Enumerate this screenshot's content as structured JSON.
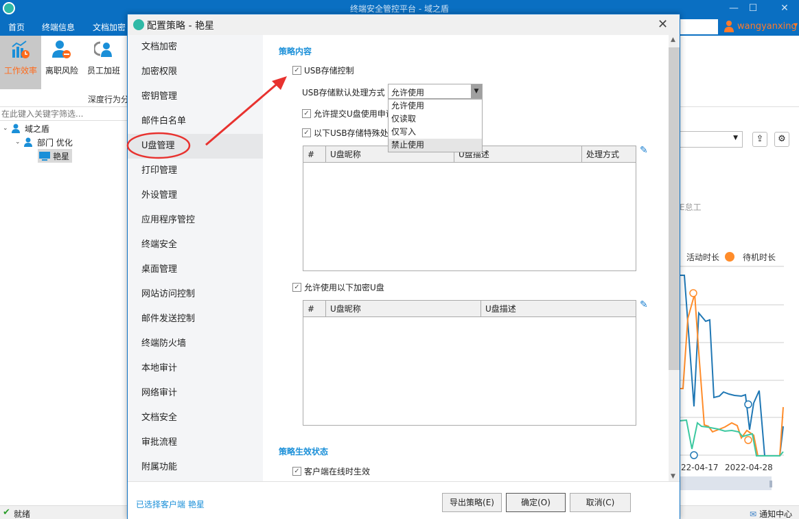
{
  "app": {
    "title": "终端安全管控平台 - 域之盾",
    "window_controls": {
      "minimize": "—",
      "maximize": "☐",
      "close": "✕"
    }
  },
  "menu": [
    "首页",
    "终端信息",
    "文档加密"
  ],
  "user": {
    "name": "wangyanxing"
  },
  "ribbon": {
    "buttons": [
      {
        "label": "工作效率",
        "icon": "efficiency-chart-icon",
        "active": true
      },
      {
        "label": "离职风险",
        "icon": "resign-risk-icon",
        "active": false
      },
      {
        "label": "员工加班",
        "icon": "overtime-icon",
        "active": false
      }
    ],
    "group_label": "深度行为分"
  },
  "left_panel": {
    "filter_placeholder": "在此键入关键字筛选...",
    "tree": [
      {
        "label": "域之盾",
        "level": 0,
        "expanded": true,
        "icon": "group-icon"
      },
      {
        "label": "部门 优化",
        "level": 1,
        "expanded": true,
        "icon": "group-icon"
      },
      {
        "label": "艳星",
        "level": 2,
        "icon": "computer-icon",
        "selected": true
      }
    ]
  },
  "background_chart": {
    "partial_text": "E怠工",
    "legend": [
      {
        "label": "活动时长",
        "color": "#1f77b4"
      },
      {
        "label": "待机时长",
        "color": "#ff8c2a"
      }
    ],
    "x_ticks": [
      "22-04-17",
      "2022-04-28"
    ],
    "series_colors": {
      "active": "#1f77b4",
      "idle": "#ff8c2a",
      "other": "#3cc8a0"
    }
  },
  "status": {
    "text": "就绪",
    "notify": "通知中心"
  },
  "dialog": {
    "title": "配置策略 - 艳星",
    "nav": [
      "文档加密",
      "加密权限",
      "密钥管理",
      "邮件白名单",
      "U盘管理",
      "打印管理",
      "外设管理",
      "应用程序管控",
      "终端安全",
      "桌面管理",
      "网站访问控制",
      "邮件发送控制",
      "终端防火墙",
      "本地审计",
      "网络审计",
      "文档安全",
      "审批流程",
      "附属功能"
    ],
    "active_nav": "U盘管理",
    "content": {
      "section1": "策略内容",
      "usb_control": {
        "label": "USB存储控制",
        "checked": true
      },
      "default_mode_label": "USB存储默认处理方式",
      "default_mode_value": "允许使用",
      "default_mode_options": [
        "允许使用",
        "仅读取",
        "仅写入",
        "禁止使用"
      ],
      "hovered_option": "禁止使用",
      "allow_apply": {
        "label": "允许提交U盘使用申请",
        "checked": true
      },
      "special_usb": {
        "label": "以下USB存储特殊处理",
        "checked": true
      },
      "table1_columns": [
        "#",
        "U盘昵称",
        "U盘描述",
        "处理方式"
      ],
      "allow_encrypted": {
        "label": "允许使用以下加密U盘",
        "checked": true
      },
      "table2_columns": [
        "#",
        "U盘昵称",
        "U盘描述"
      ],
      "section2": "策略生效状态",
      "online_effective": {
        "label": "客户端在线时生效",
        "checked": true
      }
    },
    "footer": {
      "selected_client": "已选择客户端 艳星",
      "export": "导出策略(E)",
      "ok": "确定(O)",
      "cancel": "取消(C)"
    }
  },
  "annotation": {
    "color": "#e8322f",
    "highlighted_item": "U盘管理"
  }
}
